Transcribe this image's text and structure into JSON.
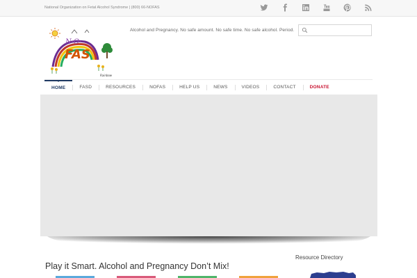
{
  "topbar": {
    "org_line": "National Organization on Fetal Alcohol Syndrome | (800) 66-NOFAS"
  },
  "social_icons": [
    "twitter-icon",
    "facebook-icon",
    "linkedin-icon",
    "youtube-icon",
    "pinterest-icon",
    "rss-icon"
  ],
  "header": {
    "tagline": "Alcohol and Pregnancy. No safe amount. No safe time. No safe alcohol. Period.",
    "search_placeholder": ""
  },
  "logo": {
    "text_top": "N·O·",
    "text_main": "FAS",
    "caption": "Rainbow"
  },
  "nav": {
    "items": [
      {
        "label": "HOME"
      },
      {
        "label": "FASD"
      },
      {
        "label": "RESOURCES"
      },
      {
        "label": "NOFAS"
      },
      {
        "label": "HELP US"
      },
      {
        "label": "NEWS"
      },
      {
        "label": "VIDEOS"
      },
      {
        "label": "CONTACT"
      },
      {
        "label": "DONATE"
      }
    ],
    "active_index": 0
  },
  "content": {
    "headline": "Play it Smart. Alcohol and Pregnancy Don’t Mix!",
    "resource_title": "Resource Directory"
  },
  "colors": {
    "nav_active": "#1f3a63",
    "donate": "#c8102e",
    "slider_bg": "#e8e8e8",
    "button_strips": [
      "#5aa9dc",
      "#d95a7a",
      "#4fb56a",
      "#f0a23c"
    ]
  }
}
